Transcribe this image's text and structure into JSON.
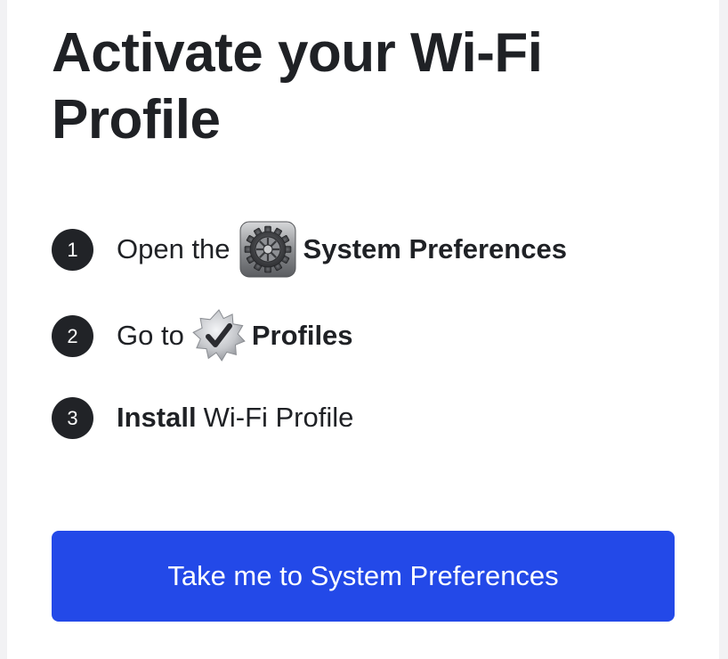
{
  "title": "Activate your Wi-Fi Profile",
  "steps": [
    {
      "number": "1",
      "prefix": "Open the",
      "icon": "system-preferences-icon",
      "bold": "System Preferences",
      "suffix": ""
    },
    {
      "number": "2",
      "prefix": "Go to",
      "icon": "profiles-badge-icon",
      "bold": "Profiles",
      "suffix": ""
    },
    {
      "number": "3",
      "prefix": "",
      "icon": "",
      "bold": "Install",
      "suffix": "Wi-Fi Profile"
    }
  ],
  "cta": {
    "label": "Take me to System Preferences"
  },
  "colors": {
    "text": "#1f2125",
    "step_circle": "#212327",
    "button": "#2349e8",
    "button_text": "#ffffff",
    "background": "#ffffff",
    "page_edge": "#f2f2f4"
  }
}
